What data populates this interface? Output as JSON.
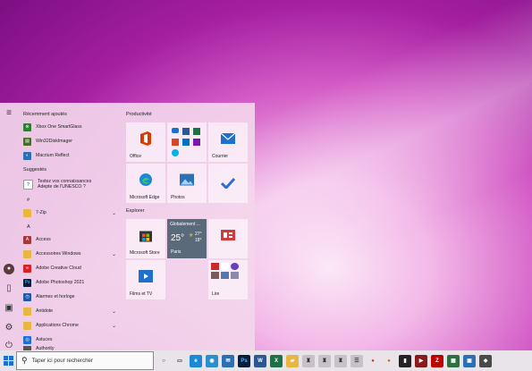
{
  "start_menu": {
    "sections": {
      "recent": "Récemment ajoutés",
      "suggested": "Suggestés"
    },
    "recent_apps": [
      {
        "label": "Xbox One SmartGlass",
        "icon": "xbox-icon",
        "color": "#2f7d32"
      },
      {
        "label": "Win32DiskImager",
        "icon": "disk-imager-icon",
        "color": "#4a6a2a"
      },
      {
        "label": "Macrium Reflect",
        "icon": "macrium-icon",
        "color": "#2b6fb5"
      }
    ],
    "suggested": {
      "line1": "Testez vos connaissances",
      "line2": "Adepte de l'UNESCO ?"
    },
    "letters": {
      "hash": "#",
      "a": "A"
    },
    "apps": [
      {
        "label": "7-Zip",
        "icon": "folder-icon",
        "color": "#e8b740",
        "expand": "⌄"
      },
      {
        "label": "Access",
        "icon": "access-icon",
        "color": "#a4373a",
        "expand": ""
      },
      {
        "label": "Accessoires Windows",
        "icon": "folder-icon",
        "color": "#e8b740",
        "expand": "⌄"
      },
      {
        "label": "Adobe Creative Cloud",
        "icon": "creative-cloud-icon",
        "color": "#da1f26",
        "expand": ""
      },
      {
        "label": "Adobe Photoshop 2021",
        "icon": "photoshop-icon",
        "color": "#0a1e3a",
        "expand": ""
      },
      {
        "label": "Alarmes et horloge",
        "icon": "clock-icon",
        "color": "#1e5aa8",
        "expand": ""
      },
      {
        "label": "Antidote",
        "icon": "folder-icon",
        "color": "#e8b740",
        "expand": "⌄"
      },
      {
        "label": "Applications Chrome",
        "icon": "folder-icon",
        "color": "#e8b740",
        "expand": "⌄"
      },
      {
        "label": "Astuces",
        "icon": "tips-icon",
        "color": "#1e6fd0",
        "expand": ""
      },
      {
        "label": "Authority",
        "icon": "authority-icon",
        "color": "#555555",
        "expand": ""
      }
    ],
    "tile_groups": {
      "productivity": "Productivité",
      "explore": "Explorer"
    },
    "tiles": {
      "office": "Office",
      "mail": "Courrier",
      "edge": "Microsoft Edge",
      "photos": "Photos",
      "store": "Microsoft Store",
      "movies": "Films et TV",
      "read": "Lire"
    },
    "weather": {
      "title": "Globalement ...",
      "temp": "25°",
      "high": "27°",
      "low": "18°",
      "city": "Paris"
    }
  },
  "taskbar": {
    "search_placeholder": "Taper ici pour rechercher",
    "icons": [
      {
        "name": "cortana-icon",
        "glyph": "○",
        "color": "#e9e3ea",
        "fg": "#222"
      },
      {
        "name": "task-view-icon",
        "glyph": "▭",
        "color": "#e9e3ea",
        "fg": "#222"
      },
      {
        "name": "edge-icon",
        "glyph": "e",
        "color": "#1b8ad6",
        "fg": "#fff"
      },
      {
        "name": "app-icon",
        "glyph": "◉",
        "color": "#2c8fc9",
        "fg": "#fff"
      },
      {
        "name": "mail-icon",
        "glyph": "✉",
        "color": "#2b6fb5",
        "fg": "#fff"
      },
      {
        "name": "photoshop-icon",
        "glyph": "Ps",
        "color": "#0a1e3a",
        "fg": "#5ab0ff"
      },
      {
        "name": "word-icon",
        "glyph": "W",
        "color": "#2b5797",
        "fg": "#fff"
      },
      {
        "name": "excel-icon",
        "glyph": "X",
        "color": "#1e7145",
        "fg": "#fff"
      },
      {
        "name": "folder-icon",
        "glyph": "▰",
        "color": "#e8b740",
        "fg": "#fff"
      },
      {
        "name": "app-icon-2",
        "glyph": "♜",
        "color": "#c8c2c8",
        "fg": "#333"
      },
      {
        "name": "app-icon-3",
        "glyph": "♜",
        "color": "#c8c2c8",
        "fg": "#333"
      },
      {
        "name": "app-icon-4",
        "glyph": "♜",
        "color": "#c8c2c8",
        "fg": "#333"
      },
      {
        "name": "notes-icon",
        "glyph": "☰",
        "color": "#c8c2c8",
        "fg": "#333"
      },
      {
        "name": "chrome-icon",
        "glyph": "●",
        "color": "#e9e3ea",
        "fg": "#d93025"
      },
      {
        "name": "firefox-icon",
        "glyph": "●",
        "color": "#e9e3ea",
        "fg": "#e66000"
      },
      {
        "name": "terminal-icon",
        "glyph": "▮",
        "color": "#222222",
        "fg": "#fff"
      },
      {
        "name": "media-icon",
        "glyph": "▶",
        "color": "#8b1a1a",
        "fg": "#fff"
      },
      {
        "name": "filezilla-icon",
        "glyph": "Z",
        "color": "#bf0000",
        "fg": "#fff"
      },
      {
        "name": "app-icon-5",
        "glyph": "▦",
        "color": "#2e6f40",
        "fg": "#fff"
      },
      {
        "name": "photos-tb-icon",
        "glyph": "▣",
        "color": "#2d6fb3",
        "fg": "#fff"
      },
      {
        "name": "app-icon-6",
        "glyph": "◆",
        "color": "#4a4a4a",
        "fg": "#fff"
      }
    ]
  }
}
